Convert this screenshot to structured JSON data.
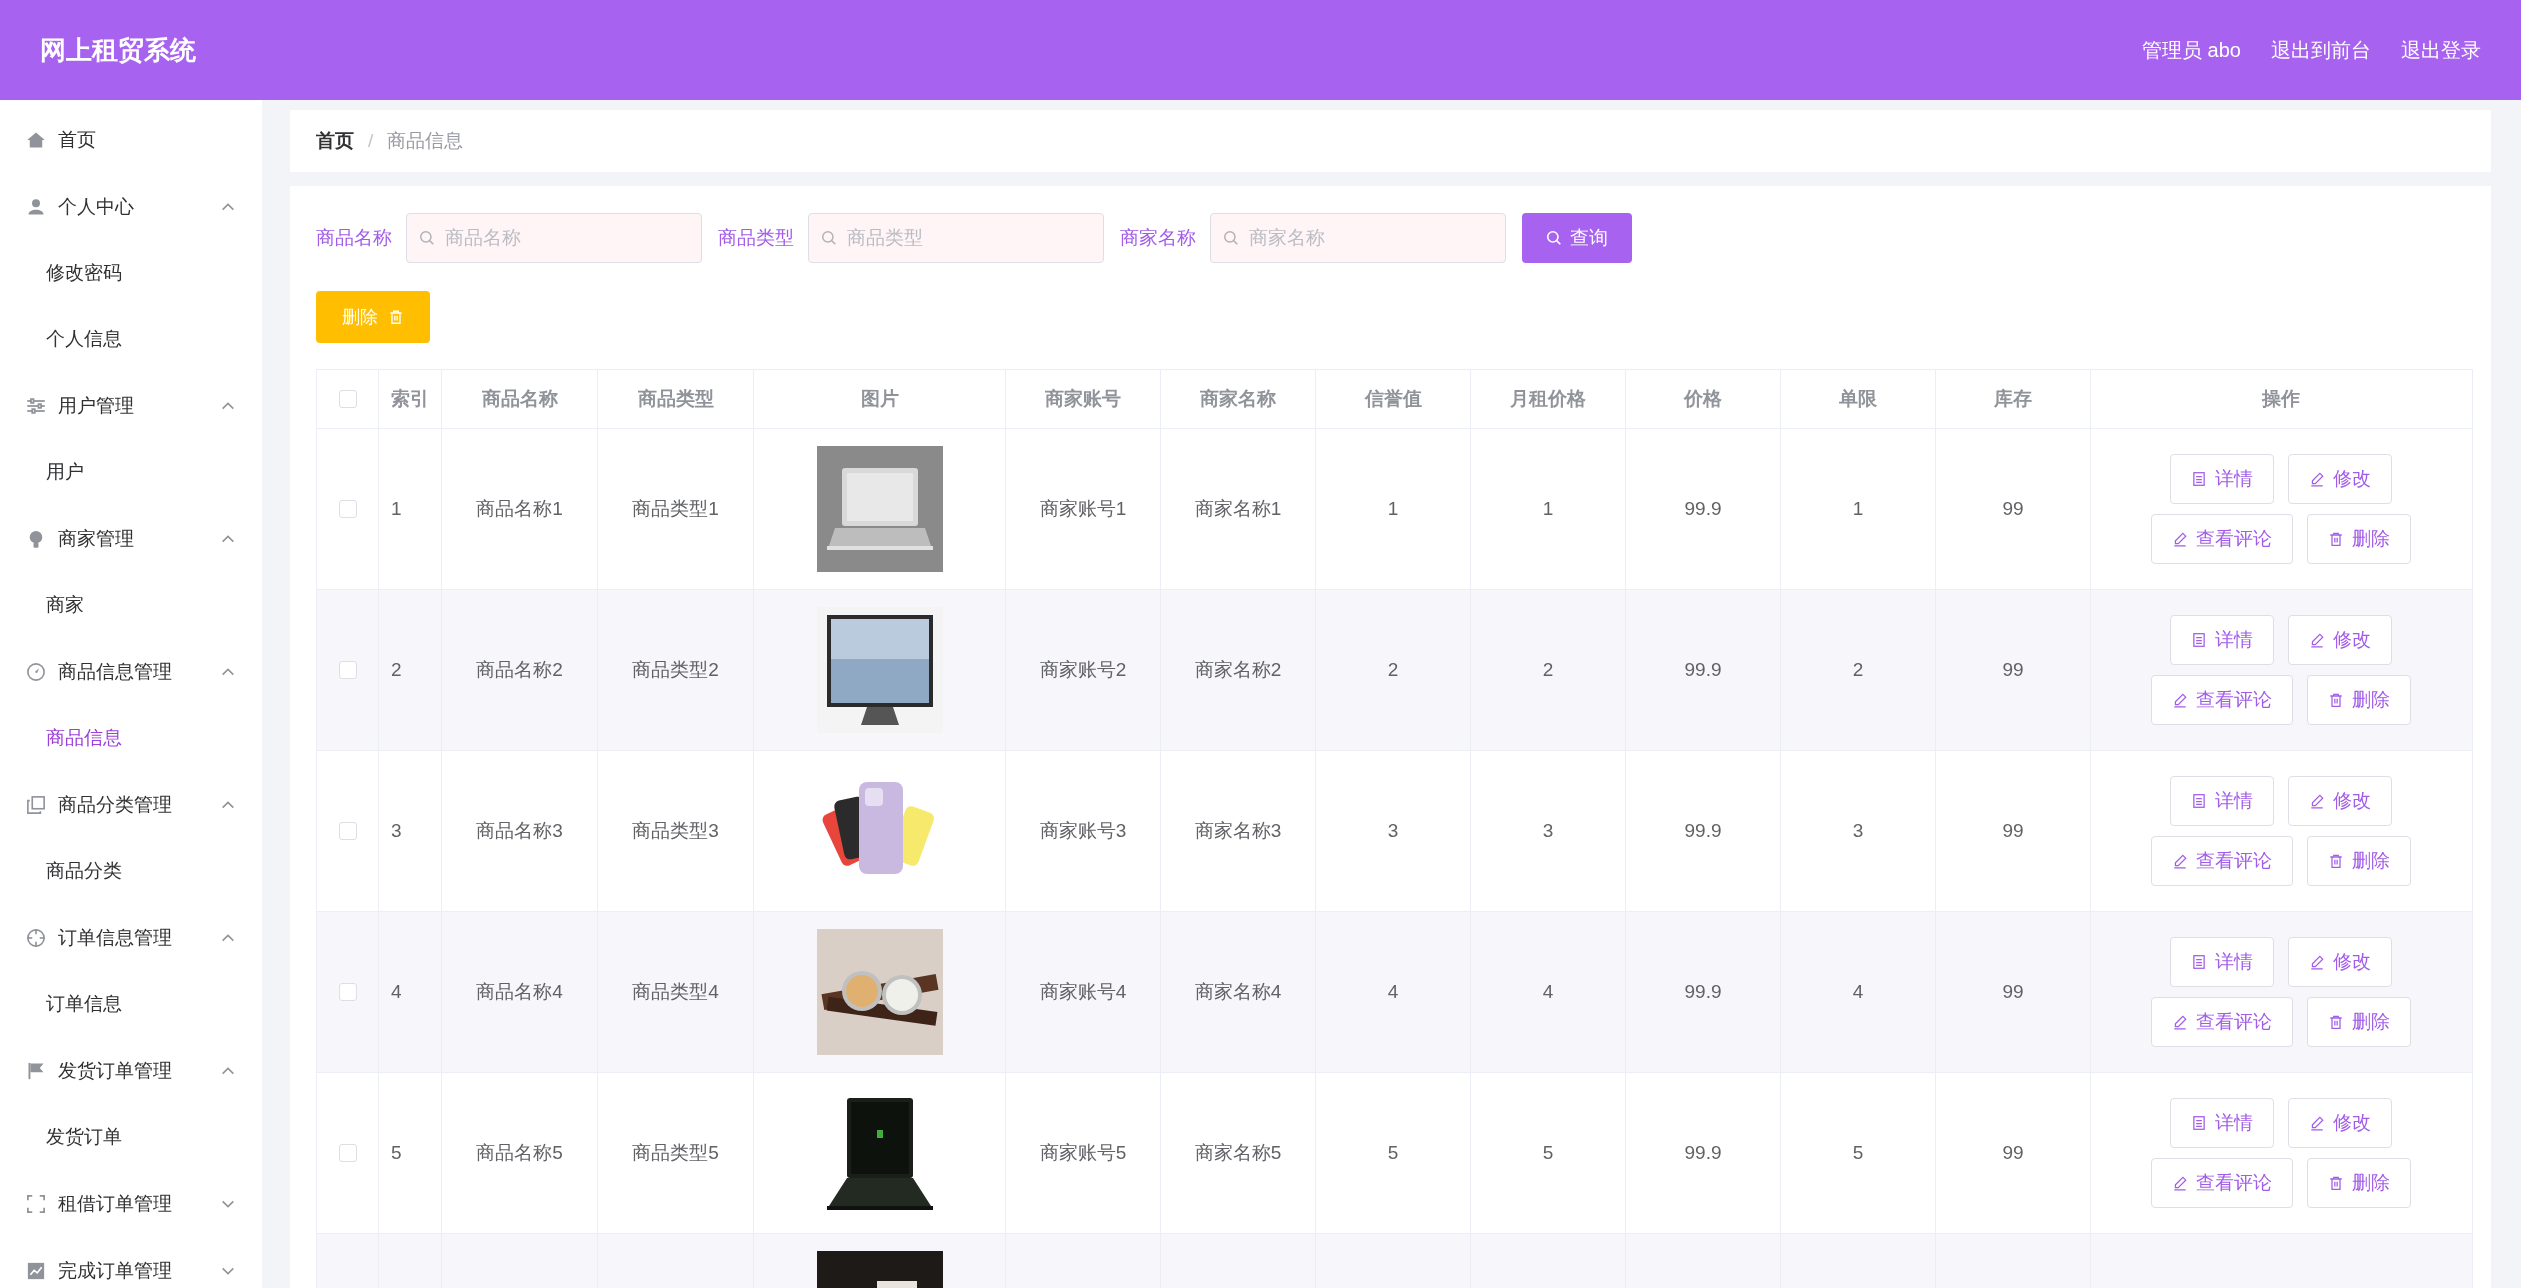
{
  "header": {
    "title": "网上租贸系统",
    "links": [
      "管理员 abo",
      "退出到前台",
      "退出登录"
    ]
  },
  "sidebar": {
    "items": [
      {
        "label": "首页"
      },
      {
        "label": "个人中心",
        "expanded": true,
        "children": [
          {
            "label": "修改密码",
            "selected": false
          },
          {
            "label": "个人信息",
            "selected": false
          }
        ]
      },
      {
        "label": "用户管理",
        "expanded": true,
        "children": [
          {
            "label": "用户",
            "selected": false
          }
        ]
      },
      {
        "label": "商家管理",
        "expanded": true,
        "children": [
          {
            "label": "商家",
            "selected": false
          }
        ]
      },
      {
        "label": "商品信息管理",
        "expanded": true,
        "children": [
          {
            "label": "商品信息",
            "selected": true
          }
        ]
      },
      {
        "label": "商品分类管理",
        "expanded": true,
        "children": [
          {
            "label": "商品分类",
            "selected": false
          }
        ]
      },
      {
        "label": "订单信息管理",
        "expanded": true,
        "children": [
          {
            "label": "订单信息",
            "selected": false
          }
        ]
      },
      {
        "label": "发货订单管理",
        "expanded": true,
        "children": [
          {
            "label": "发货订单",
            "selected": false
          }
        ]
      },
      {
        "label": "租借订单管理",
        "expanded": false
      },
      {
        "label": "完成订单管理",
        "expanded": false
      }
    ]
  },
  "breadcrumb": {
    "separator": "/",
    "items": [
      "首页",
      "商品信息"
    ]
  },
  "filters": [
    {
      "label": "商品名称",
      "placeholder": "商品名称"
    },
    {
      "label": "商品类型",
      "placeholder": "商品类型"
    },
    {
      "label": "商家名称",
      "placeholder": "商家名称"
    }
  ],
  "search_button": "查询",
  "delete_button": "删除",
  "table": {
    "select_all_checked": false,
    "columns": [
      "索引",
      "商品名称",
      "商品类型",
      "图片",
      "商家账号",
      "商家名称",
      "信誉值",
      "月租价格",
      "价格",
      "单限",
      "库存",
      "操作"
    ],
    "rows": [
      {
        "checked": false,
        "cells": [
          "1",
          "商品名称1",
          "商品类型1",
          "",
          "商家账号1",
          "商家名称1",
          "1",
          "1",
          "99.9",
          "1",
          "99",
          ""
        ],
        "actions": [
          "详情",
          "修改",
          "查看评论",
          "删除"
        ]
      },
      {
        "checked": false,
        "cells": [
          "2",
          "商品名称2",
          "商品类型2",
          "",
          "商家账号2",
          "商家名称2",
          "2",
          "2",
          "99.9",
          "2",
          "99",
          ""
        ],
        "actions": [
          "详情",
          "修改",
          "查看评论",
          "删除"
        ]
      },
      {
        "checked": false,
        "cells": [
          "3",
          "商品名称3",
          "商品类型3",
          "",
          "商家账号3",
          "商家名称3",
          "3",
          "3",
          "99.9",
          "3",
          "99",
          ""
        ],
        "actions": [
          "详情",
          "修改",
          "查看评论",
          "删除"
        ]
      },
      {
        "checked": false,
        "cells": [
          "4",
          "商品名称4",
          "商品类型4",
          "",
          "商家账号4",
          "商家名称4",
          "4",
          "4",
          "99.9",
          "4",
          "99",
          ""
        ],
        "actions": [
          "详情",
          "修改",
          "查看评论",
          "删除"
        ]
      },
      {
        "checked": false,
        "cells": [
          "5",
          "商品名称5",
          "商品类型5",
          "",
          "商家账号5",
          "商家名称5",
          "5",
          "5",
          "99.9",
          "5",
          "99",
          ""
        ],
        "actions": [
          "详情",
          "修改",
          "查看评论",
          "删除"
        ]
      },
      {
        "cells": [
          "",
          "",
          "",
          "",
          "",
          "",
          "",
          "",
          "",
          "",
          "",
          ""
        ]
      }
    ]
  }
}
